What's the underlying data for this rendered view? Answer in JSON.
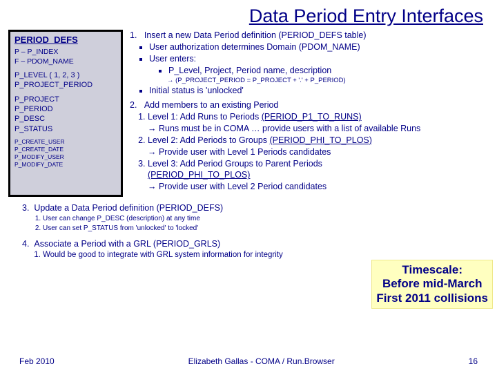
{
  "title": "Data Period Entry Interfaces",
  "defs": {
    "heading": "PERIOD_DEFS",
    "pk1": "P – P_INDEX",
    "pk2": "F – PDOM_NAME",
    "lvl1": "P_LEVEL ( 1, 2, 3 )",
    "lvl2": "P_PROJECT_PERIOD",
    "g1": "P_PROJECT",
    "g2": "P_PERIOD",
    "g3": "P_DESC",
    "g4": "P_STATUS",
    "m1": "P_CREATE_USER",
    "m2": "P_CREATE_DATE",
    "m3": "P_MODIFY_USER",
    "m4": "P_MODIFY_DATE"
  },
  "n1": {
    "title": "Insert a new Data Period definition (PERIOD_DEFS table)",
    "b1": "User authorization determines Domain (PDOM_NAME)",
    "b2": "User enters:",
    "b2a": "P_Level, Project, Period name, description",
    "b2b": "→ (P_PROJECT_PERIOD = P_PROJECT + '.' + P_PERIOD)",
    "b3": "Initial status is 'unlocked'"
  },
  "n2": {
    "title": "Add members to an existing Period",
    "l1": "Level 1: Add Runs to Periods ",
    "l1u": "(PERIOD_P1_TO_RUNS)",
    "l1a": "→ Runs must be in COMA … provide users with a list of available Runs",
    "l2": "Level 2: Add Periods to Groups ",
    "l2u": "(PERIOD_PHI_TO_PLOS)",
    "l2a": "→ Provide user with Level 1 Periods candidates",
    "l3": "Level 3: Add Period Groups to Parent Periods ",
    "l3u": "(PERIOD_PHI_TO_PLOS)",
    "l3a": "→ Provide user with Level 2 Period candidates"
  },
  "n3": {
    "title": "Update a Data Period definition (PERIOD_DEFS)",
    "s1": "User can change P_DESC (description) at any time",
    "s2": "User can set P_STATUS from 'unlocked' to 'locked'"
  },
  "n4": {
    "title": "Associate a Period with a GRL (PERIOD_GRLS)",
    "s1": "Would be good to integrate with GRL system information for integrity"
  },
  "highlight": {
    "l1": "Timescale:",
    "l2": "Before mid-March",
    "l3": "First 2011 collisions"
  },
  "footer": {
    "left": "Feb 2010",
    "center": "Elizabeth Gallas - COMA / Run.Browser",
    "right": "16"
  }
}
